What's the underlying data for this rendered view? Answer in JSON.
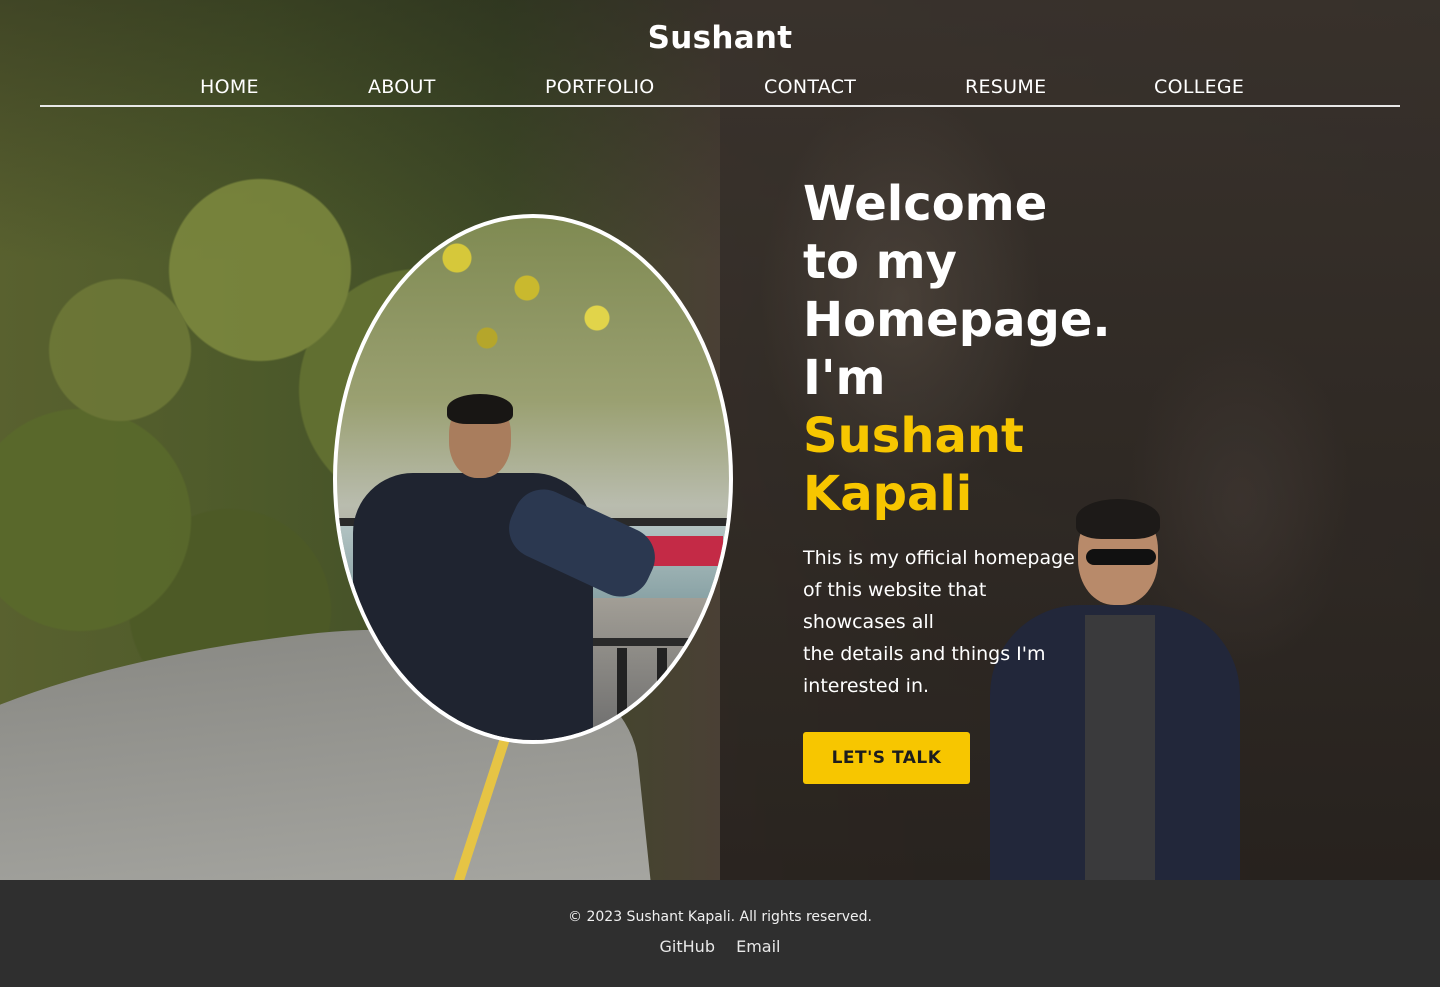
{
  "header": {
    "brand": "Sushant",
    "nav": [
      "HOME",
      "ABOUT",
      "PORTFOLIO",
      "CONTACT",
      "RESUME",
      "COLLEGE"
    ]
  },
  "hero": {
    "headline": [
      "Welcome",
      "to my",
      "Homepage.",
      "I'm"
    ],
    "name": [
      "Sushant",
      "Kapali"
    ],
    "intro": [
      "This is my official homepage",
      "of this website that",
      "showcases all",
      "the details and things I'm",
      "interested in."
    ],
    "cta_label": "LET'S TALK"
  },
  "footer": {
    "copyright": "© 2023 Sushant Kapali. All rights reserved.",
    "links": [
      "GitHub",
      "Email"
    ]
  },
  "colors": {
    "accent": "#f7c600",
    "footer_bg": "#2f2f2f",
    "text": "#ffffff"
  }
}
